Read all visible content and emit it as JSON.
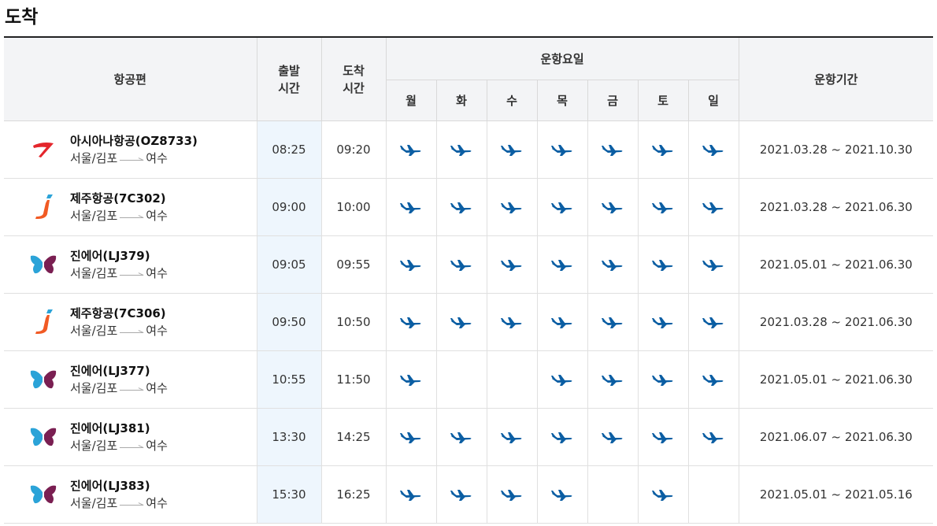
{
  "page": {
    "title": "도착"
  },
  "headers": {
    "flight": "항공편",
    "departure": "출발\n시간",
    "arrival": "도착\n시간",
    "days_group": "운항요일",
    "days": [
      "월",
      "화",
      "수",
      "목",
      "금",
      "토",
      "일"
    ],
    "period": "운항기간"
  },
  "icons": {
    "airplane": "airplane-icon",
    "plane_color": "#0b5ea3"
  },
  "airline_colors": {
    "asiana": "#e4262c",
    "jeju": "#f15a24",
    "jinair_left": "#2ba3d8",
    "jinair_right": "#7a1f52"
  },
  "rows": [
    {
      "airline": "asiana",
      "flight": "아시아나항공(OZ8733)",
      "from": "서울/김포",
      "to": "여수",
      "dep": "08:25",
      "arr": "09:20",
      "days": [
        1,
        1,
        1,
        1,
        1,
        1,
        1
      ],
      "period": "2021.03.28 ~ 2021.10.30"
    },
    {
      "airline": "jeju",
      "flight": "제주항공(7C302)",
      "from": "서울/김포",
      "to": "여수",
      "dep": "09:00",
      "arr": "10:00",
      "days": [
        1,
        1,
        1,
        1,
        1,
        1,
        1
      ],
      "period": "2021.03.28 ~ 2021.06.30"
    },
    {
      "airline": "jinair",
      "flight": "진에어(LJ379)",
      "from": "서울/김포",
      "to": "여수",
      "dep": "09:05",
      "arr": "09:55",
      "days": [
        1,
        1,
        1,
        1,
        1,
        1,
        1
      ],
      "period": "2021.05.01 ~ 2021.06.30"
    },
    {
      "airline": "jeju",
      "flight": "제주항공(7C306)",
      "from": "서울/김포",
      "to": "여수",
      "dep": "09:50",
      "arr": "10:50",
      "days": [
        1,
        1,
        1,
        1,
        1,
        1,
        1
      ],
      "period": "2021.03.28 ~ 2021.06.30"
    },
    {
      "airline": "jinair",
      "flight": "진에어(LJ377)",
      "from": "서울/김포",
      "to": "여수",
      "dep": "10:55",
      "arr": "11:50",
      "days": [
        1,
        0,
        0,
        1,
        1,
        1,
        1
      ],
      "period": "2021.05.01 ~ 2021.06.30"
    },
    {
      "airline": "jinair",
      "flight": "진에어(LJ381)",
      "from": "서울/김포",
      "to": "여수",
      "dep": "13:30",
      "arr": "14:25",
      "days": [
        1,
        1,
        1,
        1,
        1,
        1,
        1
      ],
      "period": "2021.06.07 ~ 2021.06.30"
    },
    {
      "airline": "jinair",
      "flight": "진에어(LJ383)",
      "from": "서울/김포",
      "to": "여수",
      "dep": "15:30",
      "arr": "16:25",
      "days": [
        1,
        1,
        1,
        1,
        0,
        1,
        0
      ],
      "period": "2021.05.01 ~ 2021.05.16"
    }
  ]
}
